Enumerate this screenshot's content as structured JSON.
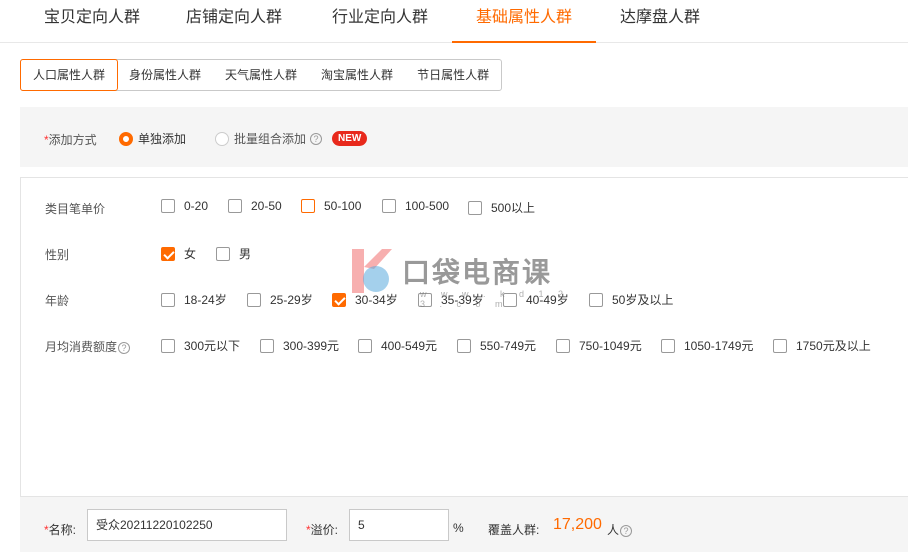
{
  "top_tabs": [
    {
      "label": "宝贝定向人群"
    },
    {
      "label": "店铺定向人群"
    },
    {
      "label": "行业定向人群"
    },
    {
      "label": "基础属性人群"
    },
    {
      "label": "达摩盘人群"
    }
  ],
  "active_top_tab": "基础属性人群",
  "sub_tabs": [
    {
      "label": "人口属性人群"
    },
    {
      "label": "身份属性人群"
    },
    {
      "label": "天气属性人群"
    },
    {
      "label": "淘宝属性人群"
    },
    {
      "label": "节日属性人群"
    }
  ],
  "active_sub_tab": "人口属性人群",
  "add_method": {
    "required_mark": "*",
    "label": "添加方式",
    "options": [
      {
        "label": "单独添加",
        "selected": true
      },
      {
        "label": "批量组合添加",
        "selected": false
      }
    ],
    "new_badge": "NEW"
  },
  "attributes": {
    "price": {
      "label": "类目笔单价",
      "options": [
        {
          "label": "0-20",
          "checked": false
        },
        {
          "label": "20-50",
          "checked": false
        },
        {
          "label": "50-100",
          "checked": false,
          "hover": true
        },
        {
          "label": "100-500",
          "checked": false
        },
        {
          "label": "500以上",
          "checked": false
        }
      ]
    },
    "gender": {
      "label": "性别",
      "options": [
        {
          "label": "女",
          "checked": true
        },
        {
          "label": "男",
          "checked": false
        }
      ]
    },
    "age": {
      "label": "年龄",
      "options": [
        {
          "label": "18-24岁",
          "checked": false
        },
        {
          "label": "25-29岁",
          "checked": false
        },
        {
          "label": "30-34岁",
          "checked": true
        },
        {
          "label": "35-39岁",
          "checked": false
        },
        {
          "label": "40-49岁",
          "checked": false
        },
        {
          "label": "50岁及以上",
          "checked": false
        }
      ]
    },
    "monthly_spend": {
      "label": "月均消费额度",
      "options": [
        {
          "label": "300元以下",
          "checked": false
        },
        {
          "label": "300-399元",
          "checked": false
        },
        {
          "label": "400-549元",
          "checked": false
        },
        {
          "label": "550-749元",
          "checked": false
        },
        {
          "label": "750-1049元",
          "checked": false
        },
        {
          "label": "1050-1749元",
          "checked": false
        },
        {
          "label": "1750元及以上",
          "checked": false
        }
      ]
    }
  },
  "watermark": {
    "text": "口袋电商课",
    "url": "w w w . k d 1 2 3 . c o m"
  },
  "bottom": {
    "required_mark": "*",
    "name_label": "名称:",
    "name_value": "受众20211220102250",
    "premium_label": "溢价:",
    "premium_value": "5",
    "premium_unit": "%",
    "coverage_label": "覆盖人群:",
    "coverage_value": "17,200",
    "coverage_unit": "人"
  },
  "colors": {
    "accent": "#ff6a00",
    "new_badge": "#e8291c",
    "panel_bg": "#f5f5f5"
  }
}
